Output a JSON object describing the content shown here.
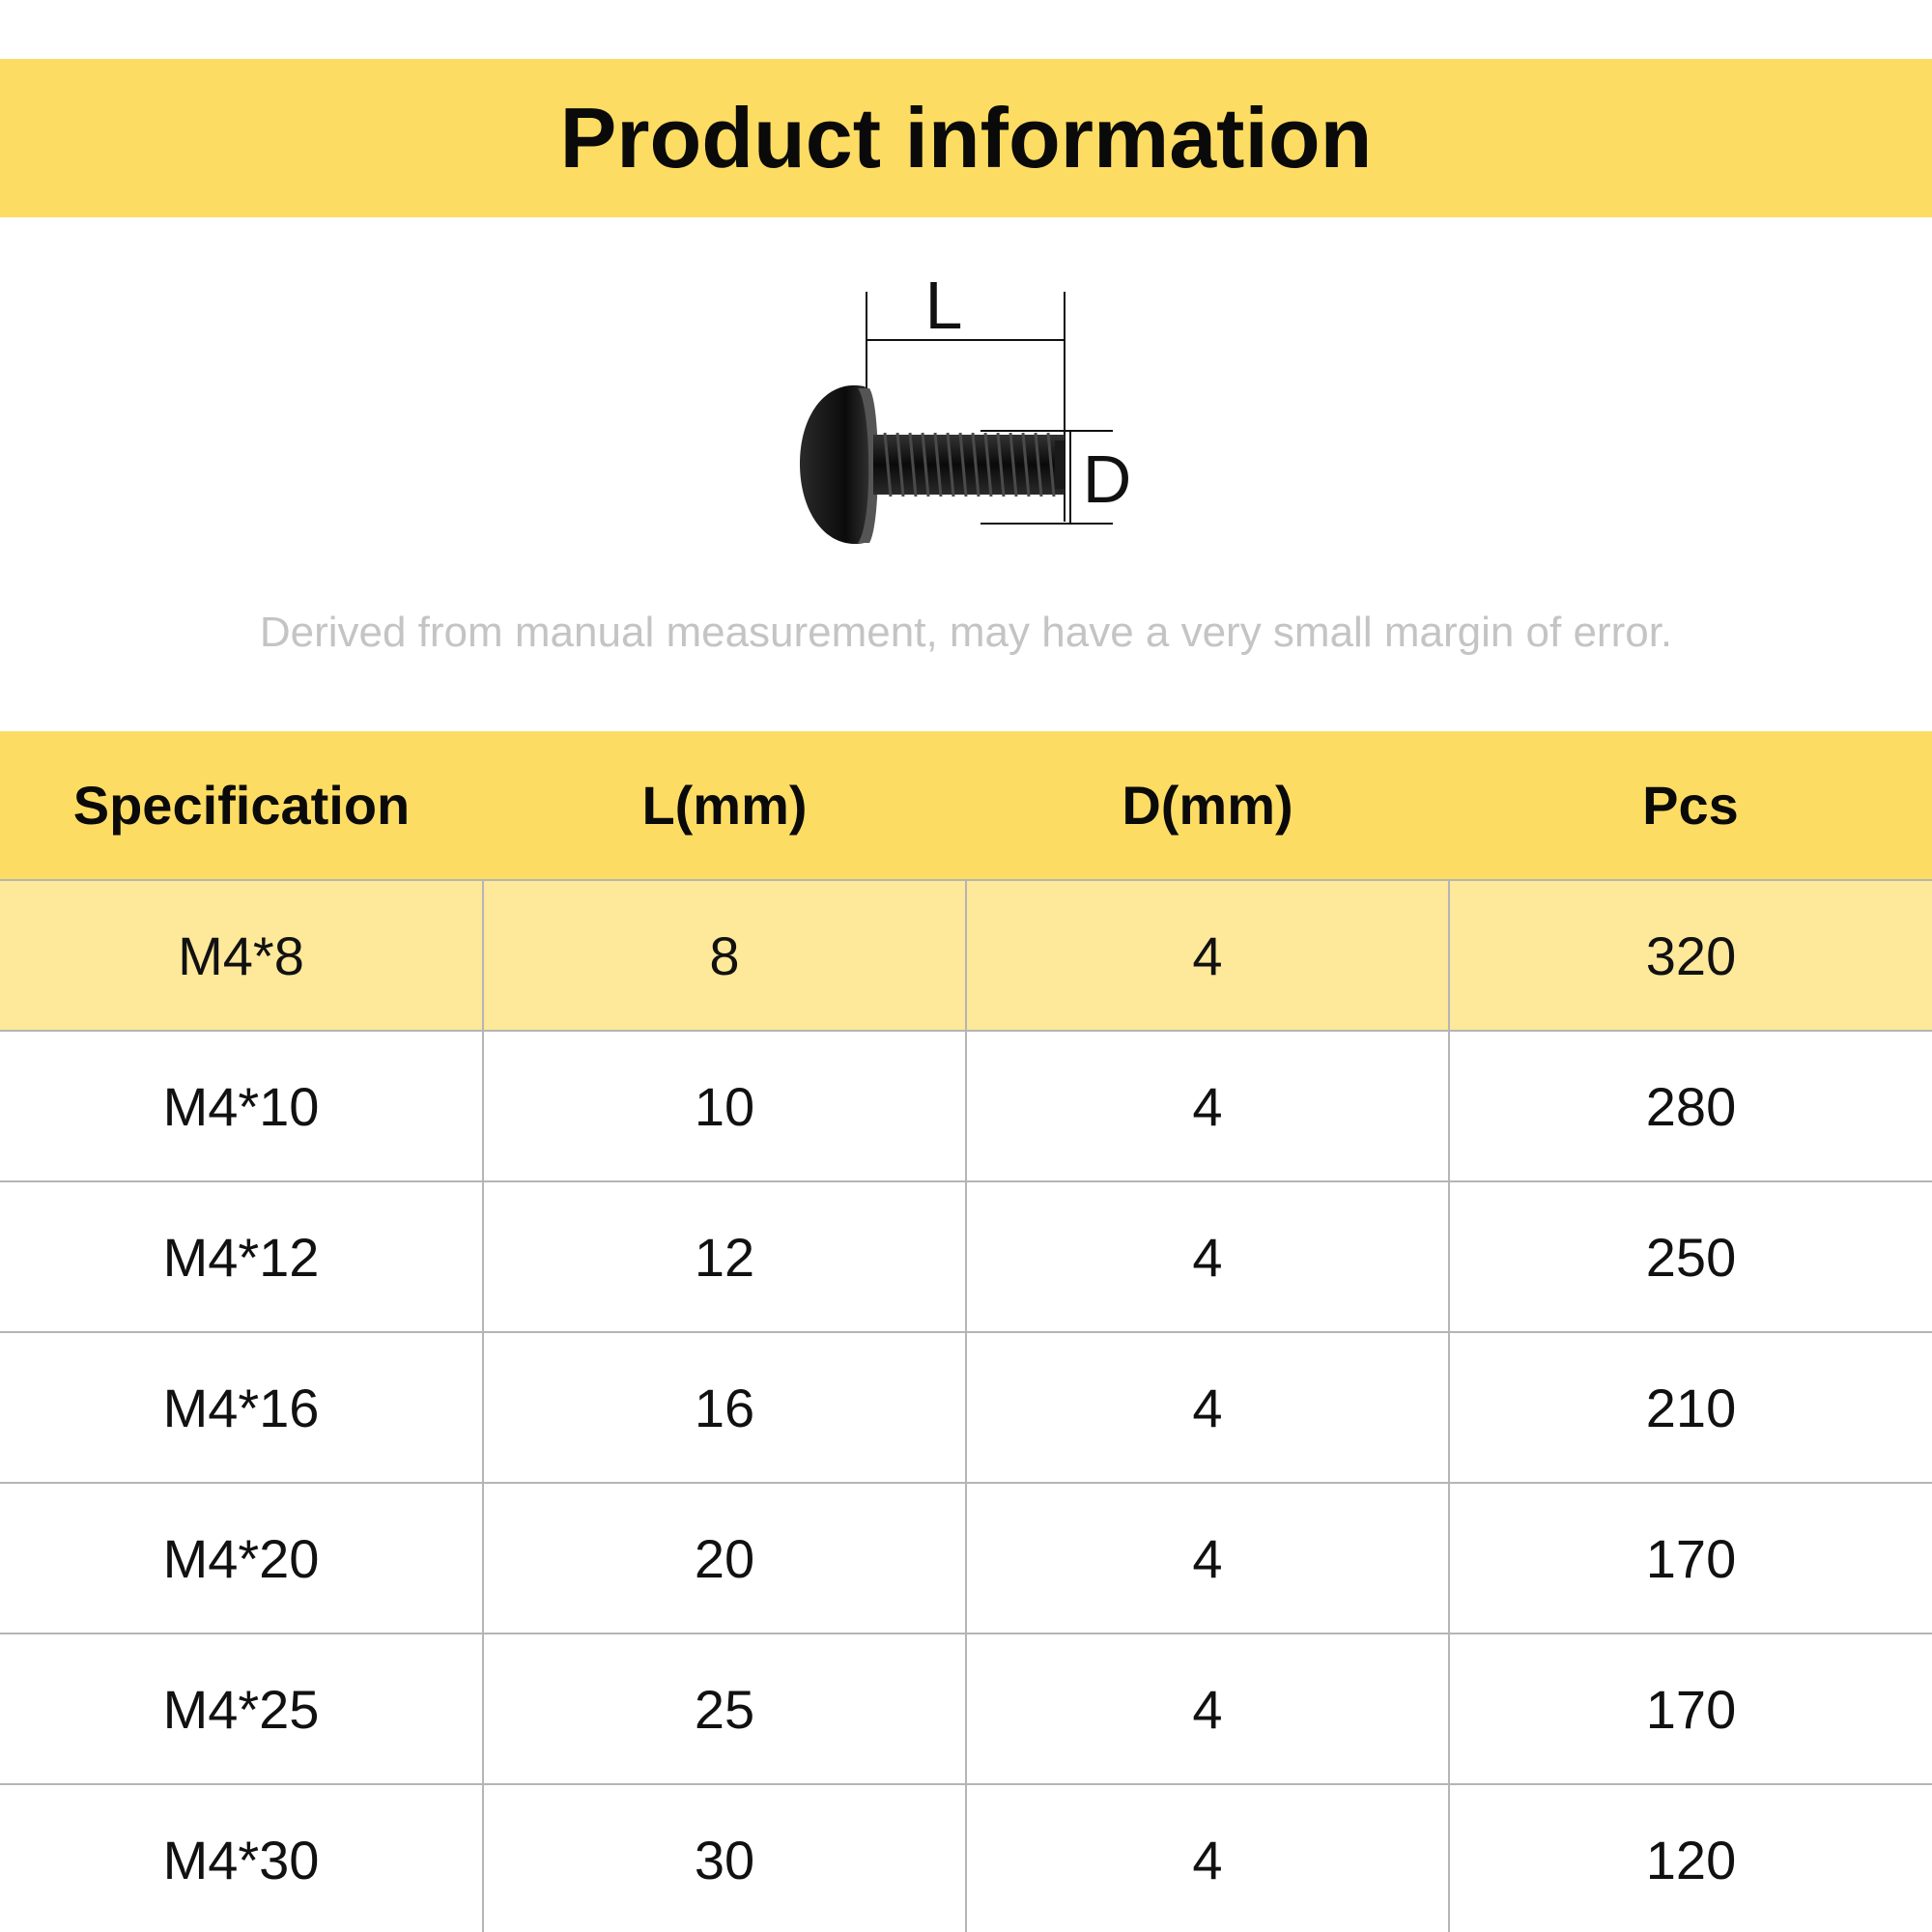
{
  "header": {
    "title": "Product information"
  },
  "diagram": {
    "length_label": "L",
    "diameter_label": "D",
    "screw_color": "#111111"
  },
  "note": {
    "text": "Derived from manual measurement, may have a very small margin of error."
  },
  "colors": {
    "accent": "#fddc63",
    "highlight_row": "#fee89a",
    "grid": "#b5b5b5",
    "note_text": "#c4c4c4"
  },
  "table": {
    "headers": [
      "Specification",
      "L(mm)",
      "D(mm)",
      "Pcs"
    ],
    "rows": [
      [
        "M4*8",
        "8",
        "4",
        "320"
      ],
      [
        "M4*10",
        "10",
        "4",
        "280"
      ],
      [
        "M4*12",
        "12",
        "4",
        "250"
      ],
      [
        "M4*16",
        "16",
        "4",
        "210"
      ],
      [
        "M4*20",
        "20",
        "4",
        "170"
      ],
      [
        "M4*25",
        "25",
        "4",
        "170"
      ],
      [
        "M4*30",
        "30",
        "4",
        "120"
      ]
    ]
  }
}
